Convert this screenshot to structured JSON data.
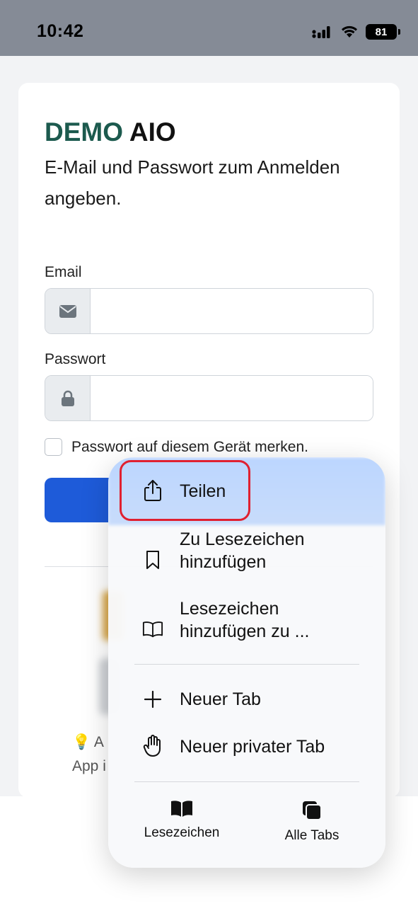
{
  "status": {
    "time": "10:42",
    "battery": "81"
  },
  "brand": {
    "part1": "DEMO",
    "part2": "AIO"
  },
  "subtitle": "E-Mail und Passwort zum Anmelden angeben.",
  "form": {
    "email_label": "Email",
    "email_value": "",
    "password_label": "Passwort",
    "password_value": "",
    "remember_label": "Passwort auf diesem Gerät merken.",
    "remember_checked": false
  },
  "hint": {
    "line1": "A",
    "line2": "App i"
  },
  "menu": {
    "items": [
      {
        "label": "Teilen",
        "icon": "share-icon"
      },
      {
        "label": "Zu Lesezeichen hinzufügen",
        "line1": "Zu Lesezeichen",
        "line2": "hinzufügen",
        "icon": "bookmark-icon"
      },
      {
        "label": "Lesezeichen hinzufügen zu ...",
        "line1": "Lesezeichen",
        "line2": "hinzufügen zu ...",
        "icon": "book-icon"
      },
      {
        "label": "Neuer Tab",
        "icon": "plus-icon"
      },
      {
        "label": "Neuer privater Tab",
        "icon": "hand-icon"
      }
    ],
    "bottom": [
      {
        "label": "Lesezeichen",
        "icon": "book-filled-icon"
      },
      {
        "label": "Alle Tabs",
        "icon": "tabs-icon"
      }
    ],
    "highlight_color": "#bcd6ff"
  },
  "colors": {
    "brand_green": "#1c5a4e",
    "primary_blue": "#1e5bd9",
    "annotation_red": "#e02030"
  }
}
